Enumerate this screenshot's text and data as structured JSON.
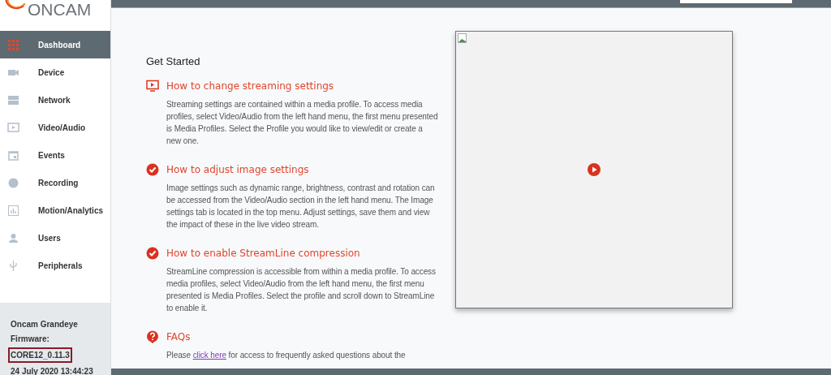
{
  "logo": {
    "text": "ONCAM"
  },
  "sidebar": {
    "items": [
      {
        "label": "Dashboard",
        "selected": true
      },
      {
        "label": "Device",
        "selected": false
      },
      {
        "label": "Network",
        "selected": false
      },
      {
        "label": "Video/Audio",
        "selected": false
      },
      {
        "label": "Events",
        "selected": false
      },
      {
        "label": "Recording",
        "selected": false
      },
      {
        "label": "Motion/Analytics",
        "selected": false
      },
      {
        "label": "Users",
        "selected": false
      },
      {
        "label": "Peripherals",
        "selected": false
      }
    ]
  },
  "device_info": {
    "model": "Oncam Grandeye",
    "firmware_label": "Firmware:",
    "firmware": "CORE12_0.11.3",
    "date": "24 July 2020 13:44:23"
  },
  "get_started": {
    "title": "Get Started",
    "sections": [
      {
        "heading": "How to change streaming settings",
        "body": "Streaming settings are contained within a media profile. To access media profiles, select Video/Audio from the left hand menu, the first menu presented is Media Profiles. Select the Profile you would like to view/edit or create a new one."
      },
      {
        "heading": "How to adjust image settings",
        "body": "Image settings such as dynamic range, brightness, contrast and rotation can be accessed from the Video/Audio section in the left hand menu. The Image settings tab is located in the top menu. Adjust settings, save them and view the impact of these in the live video stream."
      },
      {
        "heading": "How to enable StreamLine compression",
        "body": "StreamLine compression is accessible from within a media profile. To access media profiles, select Video/Audio from the left hand menu, the first menu presented is Media Profiles. Select the profile and scroll down to StreamLine to enable it."
      },
      {
        "heading": "FAQs",
        "body_before": "Please ",
        "link": "click here",
        "body_after": " for access to frequently asked questions about the"
      }
    ]
  }
}
